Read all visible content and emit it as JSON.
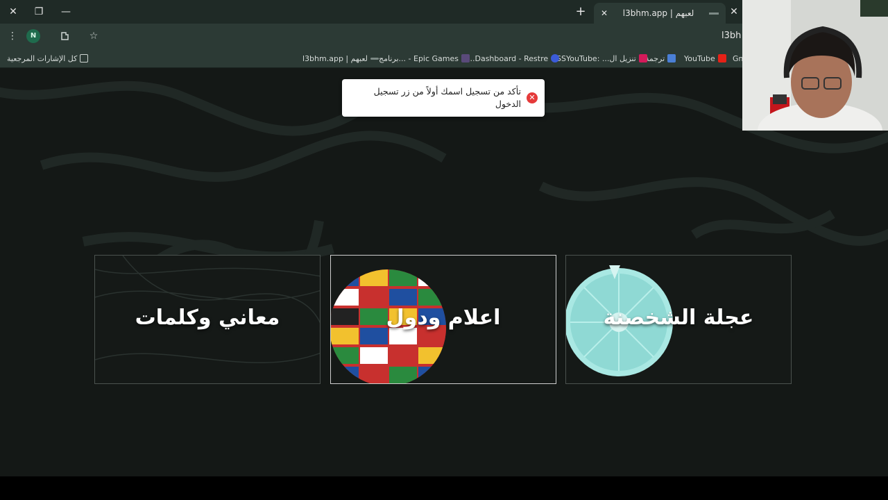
{
  "browser": {
    "tab": {
      "title": "l3bhm.app | لعبهم"
    },
    "url": "l3bh",
    "profile_initial": "N",
    "bookmarks": [
      {
        "label": "Gm"
      },
      {
        "label": "YouTube"
      },
      {
        "label": "ترجمة"
      },
      {
        "label": "تنزيل ال... :SSYouTube"
      },
      {
        "label": "...Dashboard - Restre"
      },
      {
        "label": "برنامج... - Epic Games"
      },
      {
        "label": "l3bhm.app | لعبهم"
      },
      {
        "label": "كل الإشارات المرجعية"
      }
    ]
  },
  "toast": {
    "message": "تأكد من تسجيل اسمك أولاً من زر تسجيل الدخول"
  },
  "games": [
    {
      "title": "عجلة الشخصنة"
    },
    {
      "title": "اعلام ودول"
    },
    {
      "title": "معاني وكلمات"
    }
  ],
  "colors": {
    "page_bg": "#141816",
    "chrome_bg": "#2c3a35",
    "wheel": "#8fd9d4",
    "toast_error": "#e53a3a"
  }
}
